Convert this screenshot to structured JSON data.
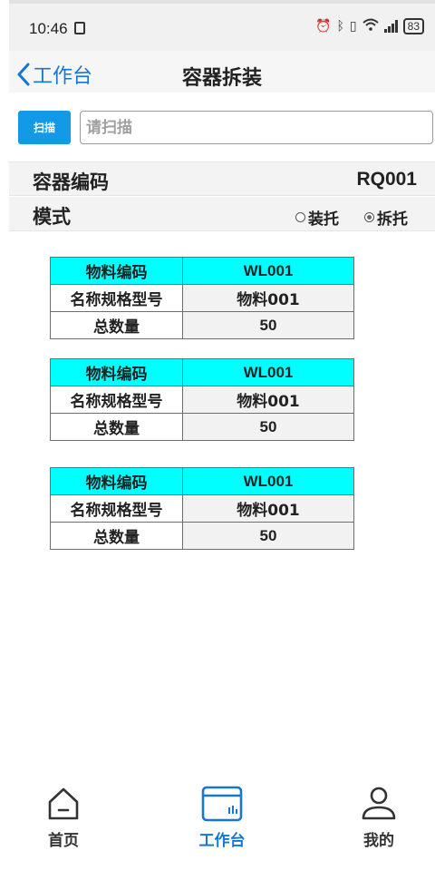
{
  "status": {
    "time": "10:46",
    "battery": "83"
  },
  "nav": {
    "back_label": "工作台",
    "title": "容器拆装"
  },
  "scan": {
    "button_label": "扫描",
    "placeholder": "请扫描",
    "value": ""
  },
  "container": {
    "label": "容器编码",
    "value": "RQ001"
  },
  "mode": {
    "label": "模式",
    "options": [
      {
        "label": "装托",
        "selected": false
      },
      {
        "label": "拆托",
        "selected": true
      }
    ]
  },
  "materials": [
    {
      "code_label": "物料编码",
      "code": "WL001",
      "name_label": "名称规格型号",
      "name": "物料001",
      "qty_label": "总数量",
      "qty": "50"
    },
    {
      "code_label": "物料编码",
      "code": "WL001",
      "name_label": "名称规格型号",
      "name": "物料001",
      "qty_label": "总数量",
      "qty": "50"
    },
    {
      "code_label": "物料编码",
      "code": "WL001",
      "name_label": "名称规格型号",
      "name": "物料001",
      "qty_label": "总数量",
      "qty": "50"
    }
  ],
  "tabs": [
    {
      "label": "首页",
      "icon": "home-icon",
      "active": false
    },
    {
      "label": "工作台",
      "icon": "workbench-icon",
      "active": true
    },
    {
      "label": "我的",
      "icon": "user-icon",
      "active": false
    }
  ],
  "colors": {
    "accent": "#1677d2",
    "scan_button": "#139ae6",
    "table_header": "#00ffff"
  }
}
